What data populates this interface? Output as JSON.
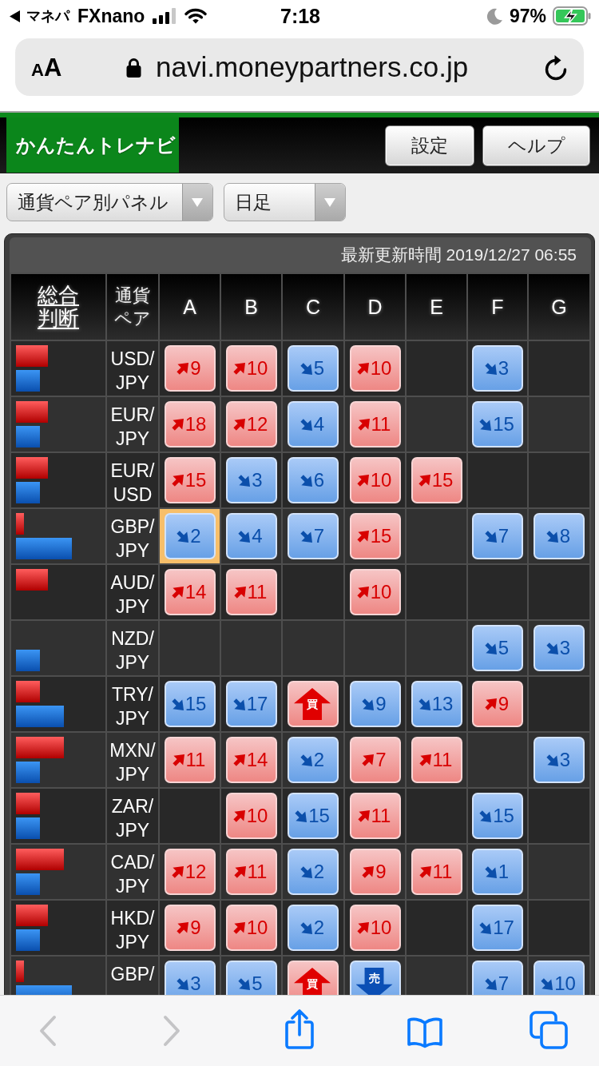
{
  "status_bar": {
    "back_app": "マネパ",
    "carrier": "FXnano",
    "time": "7:18",
    "battery": "97%"
  },
  "address_bar": {
    "reader_button": "AA",
    "url": "navi.moneypartners.co.jp"
  },
  "header": {
    "logo": "かんたんトレナビ",
    "buttons": [
      "設定",
      "ヘルプ"
    ]
  },
  "selectors": [
    {
      "value": "通貨ペア別パネル"
    },
    {
      "value": "日足"
    }
  ],
  "panel": {
    "updated": "最新更新時間 2019/12/27 06:55",
    "columns": [
      "総合判断",
      "通貨ペア",
      "A",
      "B",
      "C",
      "D",
      "E",
      "F",
      "G"
    ],
    "rows": [
      {
        "cells": [
          {
            "kind": "summary",
            "up": {
              "level": 0.4
            },
            "down": {
              "level": 0.3
            }
          },
          {
            "kind": "pair",
            "text": "USD/JPY"
          },
          {
            "kind": "up",
            "value": "9",
            "selected": false
          },
          {
            "kind": "up",
            "value": "10",
            "selected": false
          },
          {
            "kind": "down",
            "value": "5",
            "selected": false
          },
          {
            "kind": "up",
            "value": "10",
            "selected": false
          },
          {
            "kind": "empty"
          },
          {
            "kind": "down",
            "value": "3",
            "selected": false
          },
          {
            "kind": "empty"
          }
        ]
      },
      {
        "cells": [
          {
            "kind": "summary",
            "up": {
              "level": 0.4
            },
            "down": {
              "level": 0.3
            }
          },
          {
            "kind": "pair",
            "text": "EUR/JPY"
          },
          {
            "kind": "up",
            "value": "18",
            "selected": false
          },
          {
            "kind": "up",
            "value": "12",
            "selected": false
          },
          {
            "kind": "down",
            "value": "4",
            "selected": false
          },
          {
            "kind": "up",
            "value": "11",
            "selected": false
          },
          {
            "kind": "empty"
          },
          {
            "kind": "down",
            "value": "15",
            "selected": false
          },
          {
            "kind": "empty"
          }
        ]
      },
      {
        "cells": [
          {
            "kind": "summary",
            "up": {
              "level": 0.4
            },
            "down": {
              "level": 0.3
            }
          },
          {
            "kind": "pair",
            "text": "EUR/USD"
          },
          {
            "kind": "up",
            "value": "15",
            "selected": false
          },
          {
            "kind": "down",
            "value": "3",
            "selected": false
          },
          {
            "kind": "down",
            "value": "6",
            "selected": false
          },
          {
            "kind": "up",
            "value": "10",
            "selected": false
          },
          {
            "kind": "up",
            "value": "15",
            "selected": false
          },
          {
            "kind": "empty"
          },
          {
            "kind": "empty"
          }
        ]
      },
      {
        "cells": [
          {
            "kind": "summary",
            "up": {
              "level": 0.1
            },
            "down": {
              "level": 0.7
            }
          },
          {
            "kind": "pair",
            "text": "GBP/JPY"
          },
          {
            "kind": "down",
            "value": "2",
            "selected": true
          },
          {
            "kind": "down",
            "value": "4",
            "selected": false
          },
          {
            "kind": "down",
            "value": "7",
            "selected": false
          },
          {
            "kind": "up",
            "value": "15",
            "selected": false
          },
          {
            "kind": "empty"
          },
          {
            "kind": "down",
            "value": "7",
            "selected": false
          },
          {
            "kind": "down",
            "value": "8",
            "selected": false
          }
        ]
      },
      {
        "cells": [
          {
            "kind": "summary",
            "up": {
              "level": 0.4
            }
          },
          {
            "kind": "pair",
            "text": "AUD/JPY"
          },
          {
            "kind": "up",
            "value": "14",
            "selected": false
          },
          {
            "kind": "up",
            "value": "11",
            "selected": false
          },
          {
            "kind": "empty"
          },
          {
            "kind": "up",
            "value": "10",
            "selected": false
          },
          {
            "kind": "empty"
          },
          {
            "kind": "empty"
          },
          {
            "kind": "empty"
          }
        ]
      },
      {
        "cells": [
          {
            "kind": "summary",
            "down": {
              "level": 0.3
            }
          },
          {
            "kind": "pair",
            "text": "NZD/JPY"
          },
          {
            "kind": "empty"
          },
          {
            "kind": "empty"
          },
          {
            "kind": "empty"
          },
          {
            "kind": "empty"
          },
          {
            "kind": "empty"
          },
          {
            "kind": "down",
            "value": "5",
            "selected": false
          },
          {
            "kind": "down",
            "value": "3",
            "selected": false
          }
        ]
      },
      {
        "cells": [
          {
            "kind": "summary",
            "up": {
              "level": 0.3
            },
            "down": {
              "level": 0.6
            }
          },
          {
            "kind": "pair",
            "text": "TRY/JPY"
          },
          {
            "kind": "down",
            "value": "15",
            "selected": false
          },
          {
            "kind": "down",
            "value": "17",
            "selected": false
          },
          {
            "kind": "buy",
            "label": "買",
            "selected": false
          },
          {
            "kind": "down",
            "value": "9",
            "selected": false
          },
          {
            "kind": "down",
            "value": "13",
            "selected": false
          },
          {
            "kind": "up",
            "value": "9",
            "selected": false
          },
          {
            "kind": "empty"
          }
        ]
      },
      {
        "cells": [
          {
            "kind": "summary",
            "up": {
              "level": 0.6
            },
            "down": {
              "level": 0.3
            }
          },
          {
            "kind": "pair",
            "text": "MXN/JPY"
          },
          {
            "kind": "up",
            "value": "11",
            "selected": false
          },
          {
            "kind": "up",
            "value": "14",
            "selected": false
          },
          {
            "kind": "down",
            "value": "2",
            "selected": false
          },
          {
            "kind": "up",
            "value": "7",
            "selected": false
          },
          {
            "kind": "up",
            "value": "11",
            "selected": false
          },
          {
            "kind": "empty"
          },
          {
            "kind": "down",
            "value": "3",
            "selected": false
          }
        ]
      },
      {
        "cells": [
          {
            "kind": "summary",
            "up": {
              "level": 0.3
            },
            "down": {
              "level": 0.3
            }
          },
          {
            "kind": "pair",
            "text": "ZAR/JPY"
          },
          {
            "kind": "empty"
          },
          {
            "kind": "up",
            "value": "10",
            "selected": false
          },
          {
            "kind": "down",
            "value": "15",
            "selected": false
          },
          {
            "kind": "up",
            "value": "11",
            "selected": false
          },
          {
            "kind": "empty"
          },
          {
            "kind": "down",
            "value": "15",
            "selected": false
          },
          {
            "kind": "empty"
          }
        ]
      },
      {
        "cells": [
          {
            "kind": "summary",
            "up": {
              "level": 0.6
            },
            "down": {
              "level": 0.3
            }
          },
          {
            "kind": "pair",
            "text": "CAD/JPY"
          },
          {
            "kind": "up",
            "value": "12",
            "selected": false
          },
          {
            "kind": "up",
            "value": "11",
            "selected": false
          },
          {
            "kind": "down",
            "value": "2",
            "selected": false
          },
          {
            "kind": "up",
            "value": "9",
            "selected": false
          },
          {
            "kind": "up",
            "value": "11",
            "selected": false
          },
          {
            "kind": "down",
            "value": "1",
            "selected": false
          },
          {
            "kind": "empty"
          }
        ]
      },
      {
        "cells": [
          {
            "kind": "summary",
            "up": {
              "level": 0.4
            },
            "down": {
              "level": 0.3
            }
          },
          {
            "kind": "pair",
            "text": "HKD/JPY"
          },
          {
            "kind": "up",
            "value": "9",
            "selected": false
          },
          {
            "kind": "up",
            "value": "10",
            "selected": false
          },
          {
            "kind": "down",
            "value": "2",
            "selected": false
          },
          {
            "kind": "up",
            "value": "10",
            "selected": false
          },
          {
            "kind": "empty"
          },
          {
            "kind": "down",
            "value": "17",
            "selected": false
          },
          {
            "kind": "empty"
          }
        ]
      },
      {
        "cells": [
          {
            "kind": "summary",
            "up": {
              "level": 0.1
            },
            "down": {
              "level": 0.7
            }
          },
          {
            "kind": "pair",
            "text": "GBP/"
          },
          {
            "kind": "down",
            "value": "3",
            "selected": false
          },
          {
            "kind": "down",
            "value": "5",
            "selected": false
          },
          {
            "kind": "buy",
            "label": "買",
            "selected": false
          },
          {
            "kind": "sell",
            "label": "売",
            "selected": false
          },
          {
            "kind": "empty"
          },
          {
            "kind": "down",
            "value": "7",
            "selected": false
          },
          {
            "kind": "down",
            "value": "10",
            "selected": false
          }
        ]
      }
    ]
  },
  "toolbar": {
    "back": {
      "disabled": true
    },
    "forward": {
      "disabled": true
    }
  }
}
